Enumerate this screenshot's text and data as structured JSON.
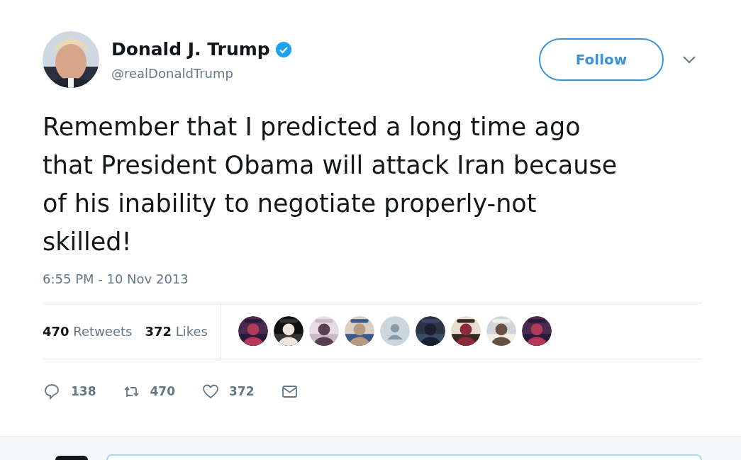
{
  "author": {
    "avatar": {
      "kind": "picture"
    },
    "name": "Donald J. Trump",
    "verified": true,
    "handle": "@realDonaldTrump"
  },
  "follow_button": {
    "label": "Follow"
  },
  "tweet": {
    "lines": [
      "Remember that I predicted a long time ago",
      "that President Obama will attack Iran because",
      "of his inability to negotiate properly-not",
      "skilled!"
    ],
    "timestamp": "6:55 PM - 10 Nov 2013"
  },
  "stats": [
    {
      "count": "470",
      "label": "Retweets"
    },
    {
      "count": "372",
      "label": "Likes"
    }
  ],
  "likers": [
    {
      "kind": "picture"
    },
    {
      "kind": "picture"
    },
    {
      "kind": "picture"
    },
    {
      "kind": "picture"
    },
    {
      "kind": "placeholder"
    },
    {
      "kind": "picture"
    },
    {
      "kind": "picture"
    },
    {
      "kind": "picture"
    },
    {
      "kind": "picture"
    }
  ],
  "actions": [
    {
      "kind": "reply",
      "count": "138"
    },
    {
      "kind": "retweet",
      "count": "470"
    },
    {
      "kind": "like",
      "count": "372"
    },
    {
      "kind": "message"
    }
  ]
}
